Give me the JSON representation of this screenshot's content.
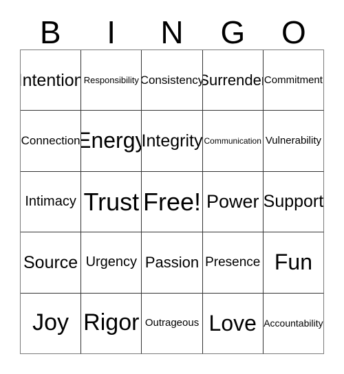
{
  "card": {
    "header": {
      "letters": [
        "B",
        "I",
        "N",
        "G",
        "O"
      ]
    },
    "grid": {
      "rows": 5,
      "columns": 5,
      "border_color": "#333333",
      "outer_border_color": "#7a7a7a",
      "background_color": "#ffffff",
      "text_color": "#000000",
      "cells": [
        [
          {
            "label": "Intention",
            "size_class": "fs-25"
          },
          {
            "label": "Responsibility",
            "size_class": "fs-13"
          },
          {
            "label": "Consistency",
            "size_class": "fs-17"
          },
          {
            "label": "Surrender",
            "size_class": "fs-22"
          },
          {
            "label": "Commitment",
            "size_class": "fs-15"
          }
        ],
        [
          {
            "label": "Connection",
            "size_class": "fs-17"
          },
          {
            "label": "Energy",
            "size_class": "fs-32"
          },
          {
            "label": "Integrity",
            "size_class": "fs-25"
          },
          {
            "label": "Communication",
            "size_class": "fs-12"
          },
          {
            "label": "Vulnerability",
            "size_class": "fs-15"
          }
        ],
        [
          {
            "label": "Intimacy",
            "size_class": "fs-20"
          },
          {
            "label": "Trust",
            "size_class": "fs-36"
          },
          {
            "label": "Free!",
            "size_class": "fs-36"
          },
          {
            "label": "Power",
            "size_class": "fs-27"
          },
          {
            "label": "Support",
            "size_class": "fs-25"
          }
        ],
        [
          {
            "label": "Source",
            "size_class": "fs-25"
          },
          {
            "label": "Urgency",
            "size_class": "fs-20"
          },
          {
            "label": "Passion",
            "size_class": "fs-22"
          },
          {
            "label": "Presence",
            "size_class": "fs-19"
          },
          {
            "label": "Fun",
            "size_class": "fs-32"
          }
        ],
        [
          {
            "label": "Joy",
            "size_class": "fs-34"
          },
          {
            "label": "Rigor",
            "size_class": "fs-34"
          },
          {
            "label": "Outrageous",
            "size_class": "fs-15"
          },
          {
            "label": "Love",
            "size_class": "fs-32"
          },
          {
            "label": "Accountability",
            "size_class": "fs-14"
          }
        ]
      ]
    }
  }
}
